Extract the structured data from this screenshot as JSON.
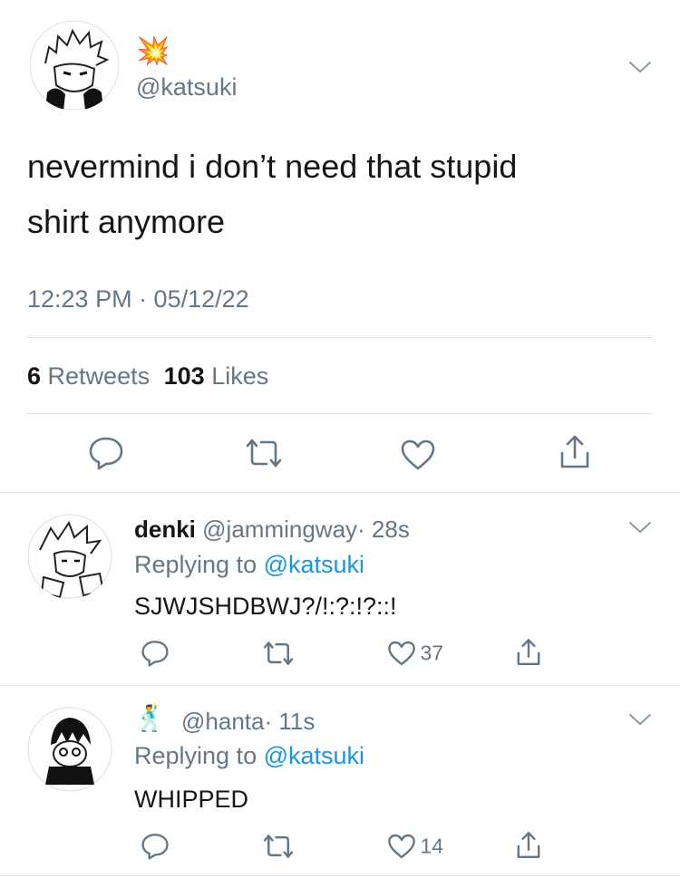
{
  "main_tweet": {
    "display_emoji": "💥",
    "handle": "@katsuki",
    "text_line1": "nevermind i don’t need that stupid",
    "text_line2": "shirt anymore",
    "timestamp": "12:23 PM · 05/12/22",
    "retweets_count": "6",
    "retweets_label": "Retweets",
    "likes_count": "103",
    "likes_label": "Likes"
  },
  "replies": [
    {
      "display_name": "denki",
      "handle": "@jammingway",
      "time": "· 28s",
      "replying_prefix": "Replying to",
      "replying_to": "@katsuki",
      "text": "SJWJSHDBWJ?/!:?:!?::!",
      "likes": "37"
    },
    {
      "display_emoji": "🕺",
      "handle": "@hanta",
      "time": "· 11s",
      "replying_prefix": "Replying to",
      "replying_to": "@katsuki",
      "text": "WHIPPED",
      "likes": "14"
    }
  ],
  "icons": [
    "reply-icon",
    "retweet-icon",
    "like-icon",
    "share-icon",
    "chevron-down-icon"
  ],
  "colors": {
    "text": "#14171a",
    "secondary": "#657786",
    "link": "#1b95e0",
    "divider": "#dfe4e8"
  }
}
